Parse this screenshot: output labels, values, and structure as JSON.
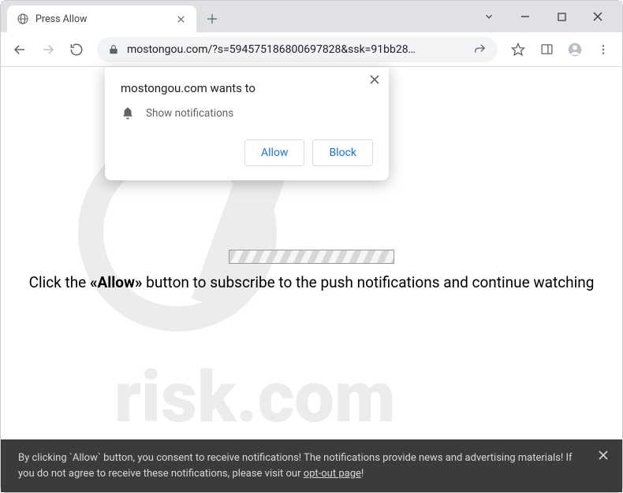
{
  "window": {
    "tab_title": "Press Allow"
  },
  "address": {
    "url": "mostongou.com/?s=594575186800697828&ssk=91bb28…"
  },
  "permission": {
    "title": "mostongou.com wants to",
    "row_label": "Show notifications",
    "allow_label": "Allow",
    "block_label": "Block"
  },
  "page": {
    "msg_prefix": "Click the ",
    "msg_strong": "«Allow»",
    "msg_suffix": " button to subscribe to the push notifications and continue watching"
  },
  "consent": {
    "text_part1": "By clicking `Allow` button, you consent to receive notifications! The notifications provide news and advertising materials! If you do not agree to receive these notifications, please visit our ",
    "link_text": "opt-out page",
    "text_part2": "!"
  }
}
